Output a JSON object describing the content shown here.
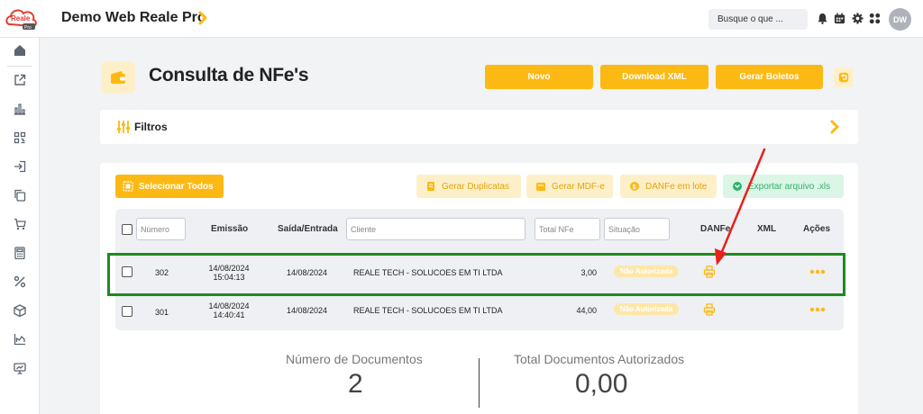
{
  "app": {
    "title": "Demo Web Reale Pro",
    "logo_text": "Reale",
    "logo_sub": "Pro",
    "search_placeholder": "Busque o que ...",
    "avatar_initials": "DW",
    "accent": "#fdb913"
  },
  "sidebar": {
    "icons": [
      "home-icon",
      "external-link-icon",
      "bar-chart-icon",
      "qr-scan-icon",
      "login-icon",
      "copy-icon",
      "cart-icon",
      "calculator-icon",
      "percent-icon",
      "box-icon",
      "area-chart-icon",
      "presentation-icon"
    ]
  },
  "page": {
    "title": "Consulta de NFe's",
    "buttons": {
      "novo": "Novo",
      "download_xml": "Download XML",
      "gerar_boletos": "Gerar Boletos"
    }
  },
  "filters": {
    "label": "Filtros"
  },
  "toolbar": {
    "select_all": "Selecionar Todos",
    "gerar_duplicatas": "Gerar Duplicatas",
    "gerar_mdfe": "Gerar MDF-e",
    "danfe_lote": "DANFe em lote",
    "exportar": "Exportar arquivo .xls"
  },
  "table": {
    "headers": {
      "numero_placeholder": "Número",
      "emissao": "Emissão",
      "saida_entrada": "Saída/Entrada",
      "cliente_placeholder": "Cliente",
      "total_placeholder": "Total NFe",
      "situacao_placeholder": "Situação",
      "danfe": "DANFe",
      "xml": "XML",
      "acoes": "Ações"
    },
    "rows": [
      {
        "numero": "302",
        "emissao_date": "14/08/2024",
        "emissao_time": "15:04:13",
        "saida": "14/08/2024",
        "cliente": "REALE TECH - SOLUCOES EM TI LTDA",
        "total": "3,00",
        "situacao": "Não Autorizada"
      },
      {
        "numero": "301",
        "emissao_date": "14/08/2024",
        "emissao_time": "14:40:41",
        "saida": "14/08/2024",
        "cliente": "REALE TECH - SOLUCOES EM TI LTDA",
        "total": "44,00",
        "situacao": "Não Autorizada"
      }
    ]
  },
  "summary": {
    "num_docs_label": "Número de Documentos",
    "num_docs_value": "2",
    "total_label": "Total Documentos Autorizados",
    "total_value": "0,00"
  },
  "annotations": {
    "highlight_color": "#1e8a1e",
    "arrow_color": "#e8201e"
  }
}
